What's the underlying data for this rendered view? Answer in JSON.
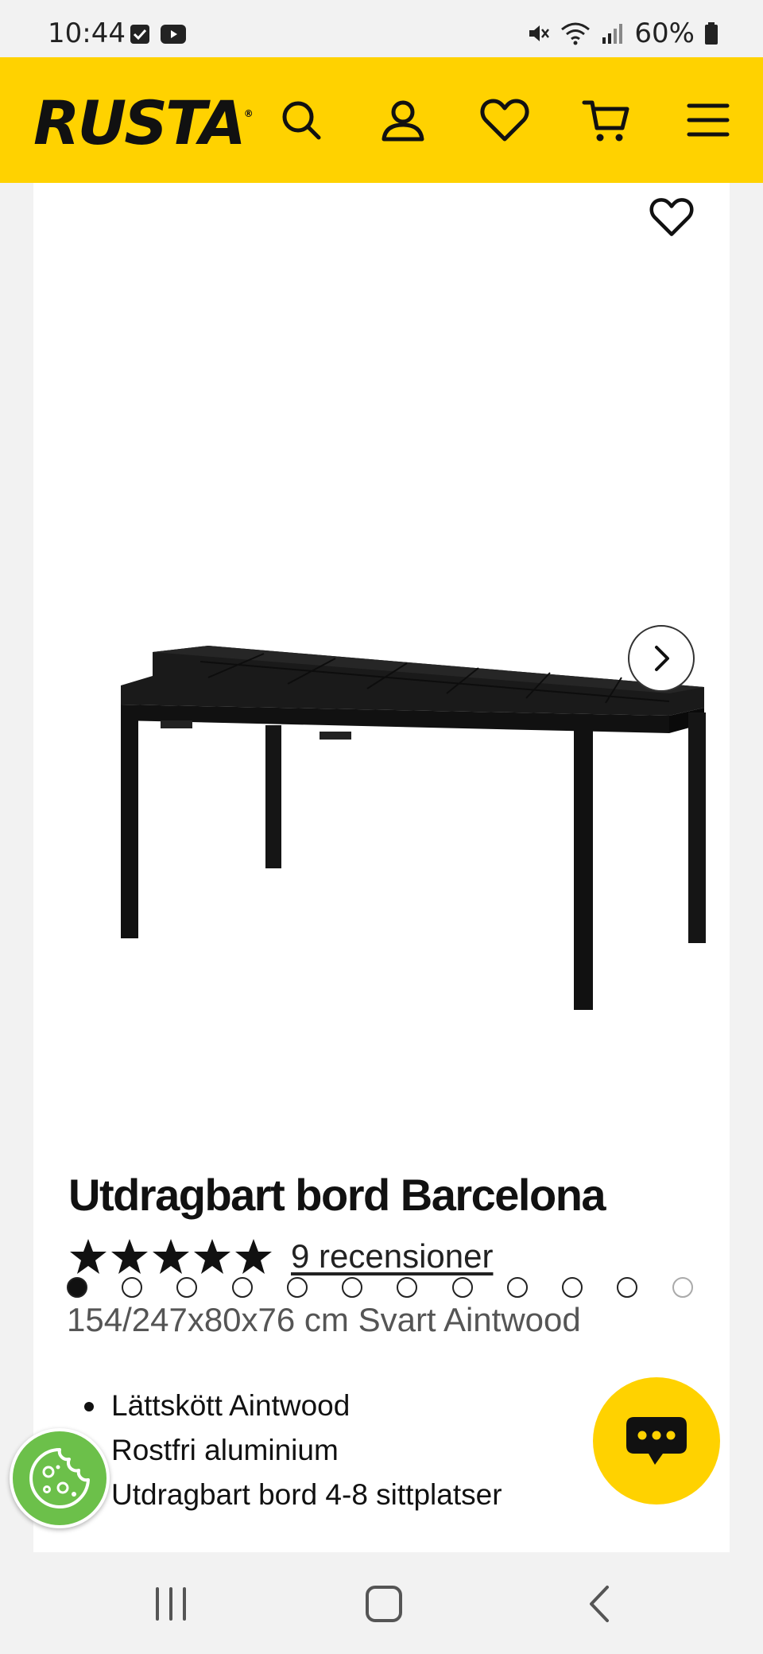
{
  "status_bar": {
    "time": "10:44",
    "battery": "60%"
  },
  "header": {
    "logo": "RUSTA",
    "logo_mark": "®",
    "icons": [
      "search-icon",
      "account-icon",
      "heart-icon",
      "cart-icon",
      "menu-icon"
    ],
    "accent_color": "#ffd200"
  },
  "gallery": {
    "image_count": 12,
    "active_index": 0
  },
  "product": {
    "title": "Utdragbart bord Barcelona",
    "rating_stars": 5,
    "reviews_label": "9 recensioner",
    "subtitle": "154/247x80x76 cm Svart Aintwood",
    "features": [
      "Lättskött Aintwood",
      "Rostfri aluminium",
      "Utdragbart bord 4-8 sittplatser"
    ]
  },
  "colors": {
    "cookie_button": "#6cc04a",
    "chat_button": "#ffd200"
  }
}
